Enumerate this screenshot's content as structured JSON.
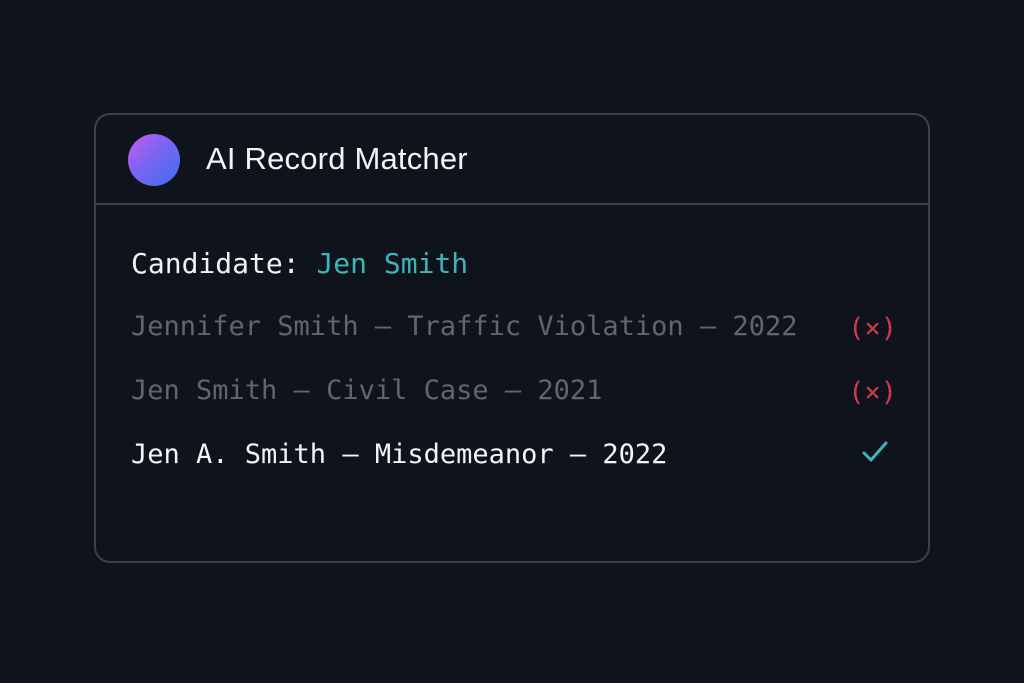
{
  "header": {
    "title": "AI Record Matcher"
  },
  "candidate": {
    "label": "Candidate:",
    "name": "Jen Smith"
  },
  "records": [
    {
      "text": "Jennifer Smith – Traffic Violation – 2022",
      "status": "rejected",
      "status_glyph": "(×)"
    },
    {
      "text": "Jen Smith – Civil Case – 2021",
      "status": "rejected",
      "status_glyph": "(×)"
    },
    {
      "text": "Jen A. Smith – Misdemeanor – 2022",
      "status": "matched"
    }
  ],
  "icons": {
    "logo": "gradient-orb-icon",
    "reject": "reject-x-icon",
    "match": "check-icon"
  },
  "colors": {
    "background": "#0f141c",
    "accent": "#3fb3ba",
    "reject": "#d23a4a",
    "match": "#3fb3ba",
    "muted_text": "#5f6670",
    "primary_text": "#f2f4f7"
  }
}
